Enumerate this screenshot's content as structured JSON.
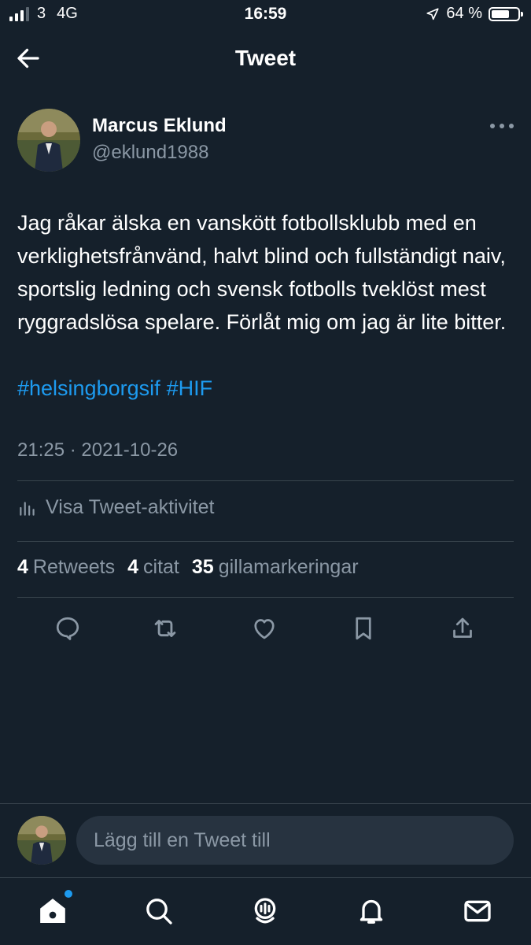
{
  "status_bar": {
    "carrier": "3",
    "network": "4G",
    "time": "16:59",
    "battery_percent_text": "64 %",
    "battery_level": 0.64,
    "signal_bars_filled": 3,
    "signal_bars_total": 4
  },
  "header": {
    "title": "Tweet",
    "back_icon": "arrow-left-icon"
  },
  "tweet": {
    "author": {
      "name": "Marcus Eklund",
      "handle": "@eklund1988"
    },
    "text": "Jag råkar älska en vanskött fotbollsklubb med en verklighetsfrånvänd, halvt blind och fullständigt naiv, sportslig ledning och svensk fotbolls tveklöst mest ryggradslösa spelare. Förlåt mig om jag är lite bitter.",
    "hashtags": [
      "#helsingborgsif",
      "#HIF"
    ],
    "timestamp": "21:25 · 2021-10-26",
    "activity_label": "Visa Tweet-aktivitet",
    "stats": {
      "retweets_count": "4",
      "retweets_label": "Retweets",
      "quotes_count": "4",
      "quotes_label": "citat",
      "likes_count": "35",
      "likes_label": "gillamarkeringar"
    },
    "actions": [
      "reply-icon",
      "retweet-icon",
      "like-icon",
      "bookmark-icon",
      "share-icon"
    ]
  },
  "reply": {
    "placeholder": "Lägg till en Tweet till"
  },
  "tabbar": {
    "tabs": [
      "home-icon",
      "search-icon",
      "spaces-icon",
      "notifications-icon",
      "messages-icon"
    ],
    "active": "home"
  },
  "colors": {
    "background": "#15202b",
    "accent": "#1d9bf0",
    "secondary_text": "#8b98a5",
    "divider": "#38444d"
  }
}
